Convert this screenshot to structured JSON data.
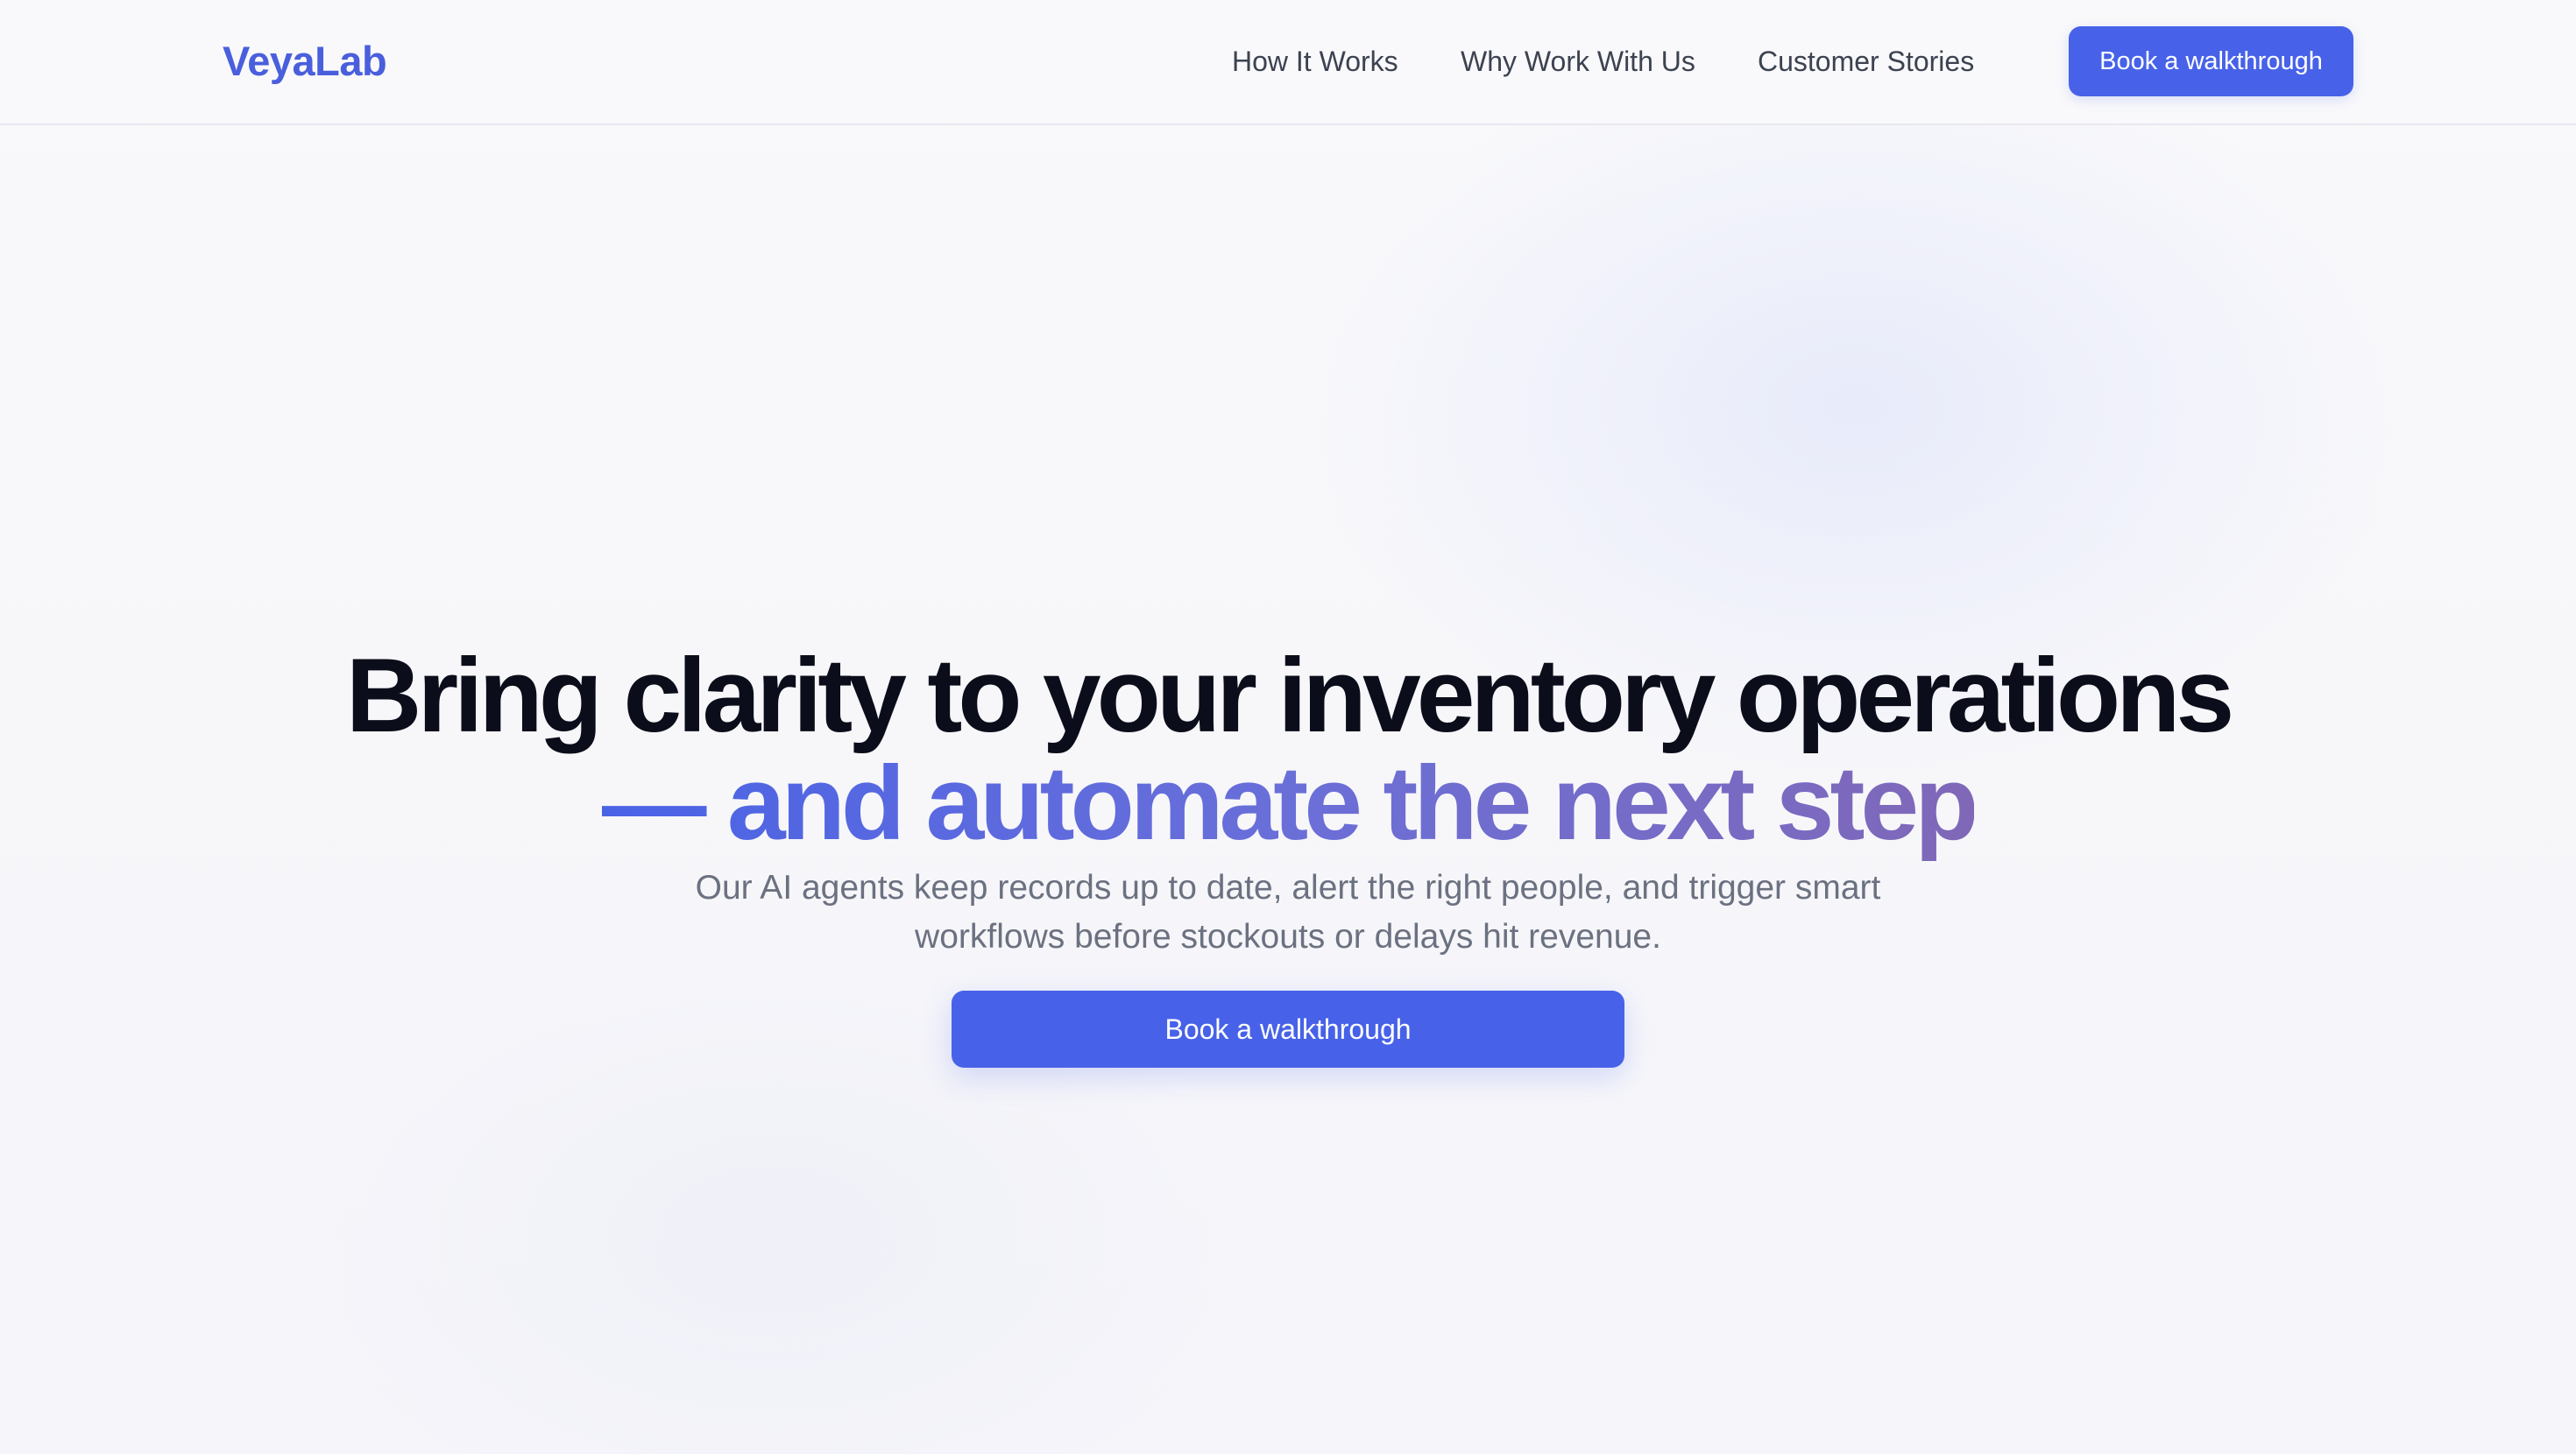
{
  "header": {
    "logo": "VeyaLab",
    "nav": [
      "How It Works",
      "Why Work With Us",
      "Customer Stories"
    ],
    "cta_label": "Book a walkthrough"
  },
  "hero": {
    "headline_line1": "Bring clarity to your inventory operations",
    "headline_line2": "— and automate the next step",
    "subtitle_line1": "Our AI agents keep records up to date, alert the right people, and trigger smart",
    "subtitle_line2": "workflows before stockouts or delays hit revenue.",
    "cta_label": "Book a walkthrough"
  },
  "colors": {
    "brand": "#4a5fdc",
    "button": "#4762e8",
    "headline": "#0b0d1a",
    "gradient_start": "#4a63e6",
    "gradient_end": "#8068b8",
    "muted_text": "#6b7180"
  }
}
